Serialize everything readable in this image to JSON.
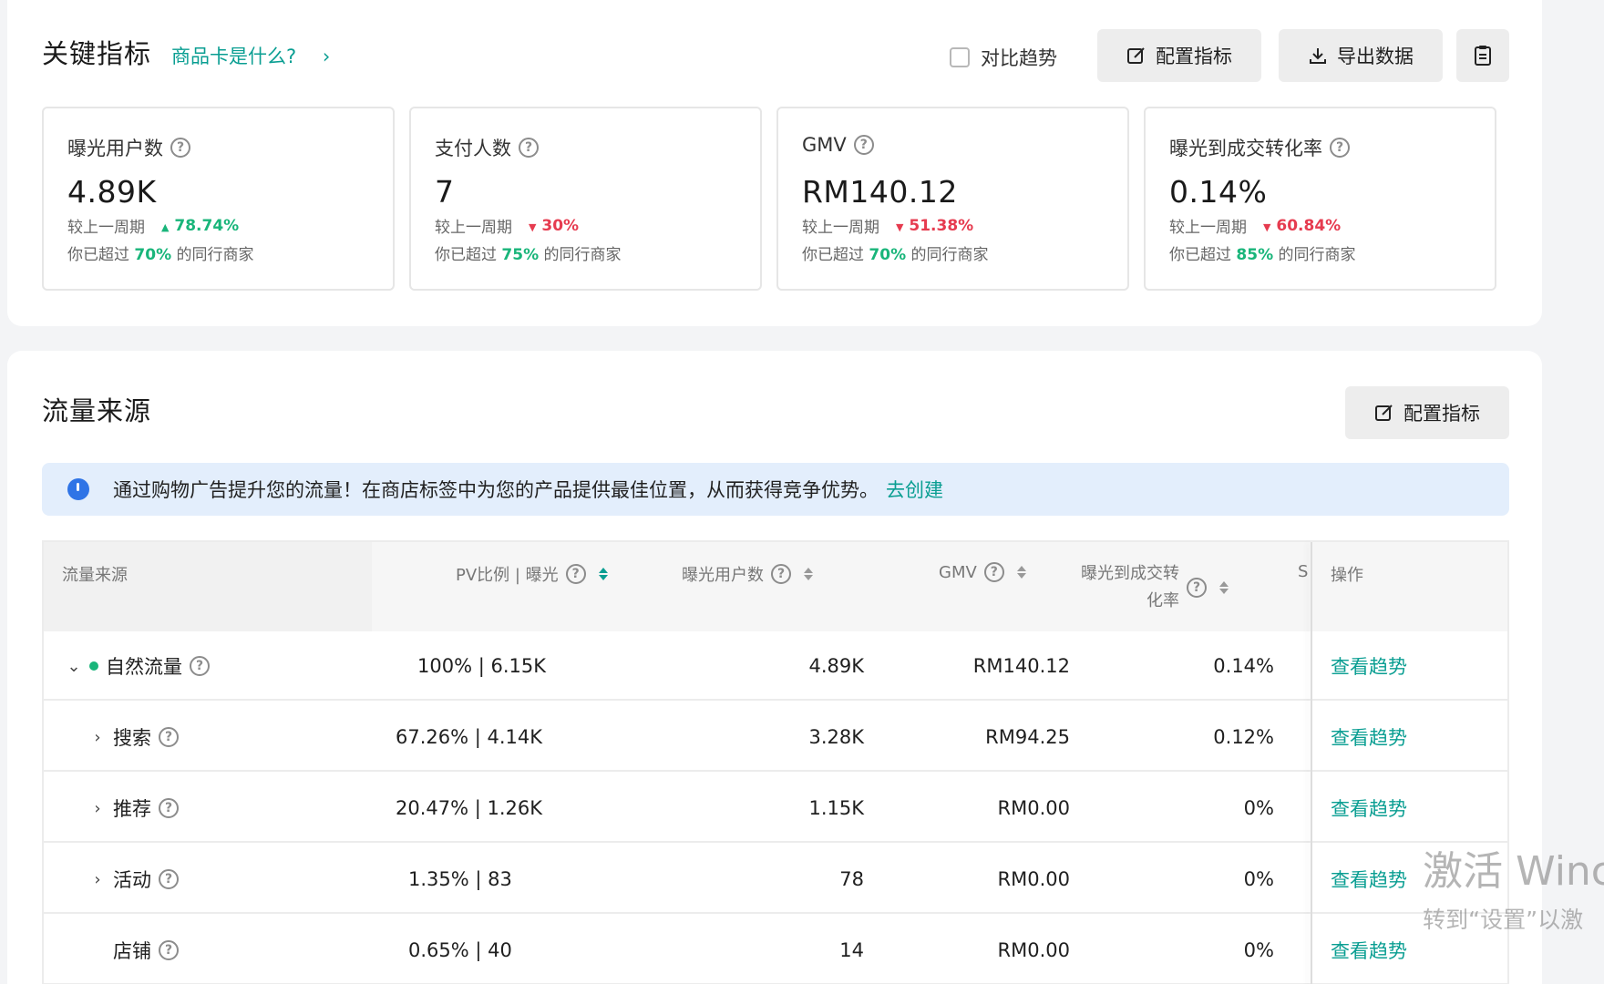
{
  "key_metrics": {
    "title": "关键指标",
    "help_link": "商品卡是什么?",
    "help_chevron": "›",
    "compare_label": "对比趋势",
    "config_button": "配置指标",
    "export_button": "导出数据",
    "cards": [
      {
        "title": "曝光用户数",
        "value": "4.89K",
        "compare_label": "较上一周期",
        "trend": "up",
        "trend_arrow": "▲",
        "change": "78.74%",
        "rank_prefix": "你已超过",
        "rank_pct": "70%",
        "rank_suffix": "的同行商家"
      },
      {
        "title": "支付人数",
        "value": "7",
        "compare_label": "较上一周期",
        "trend": "down",
        "trend_arrow": "▼",
        "change": "30%",
        "rank_prefix": "你已超过",
        "rank_pct": "75%",
        "rank_suffix": "的同行商家"
      },
      {
        "title": "GMV",
        "value": "RM140.12",
        "compare_label": "较上一周期",
        "trend": "down",
        "trend_arrow": "▼",
        "change": "51.38%",
        "rank_prefix": "你已超过",
        "rank_pct": "70%",
        "rank_suffix": "的同行商家"
      },
      {
        "title": "曝光到成交转化率",
        "value": "0.14%",
        "compare_label": "较上一周期",
        "trend": "down",
        "trend_arrow": "▼",
        "change": "60.84%",
        "rank_prefix": "你已超过",
        "rank_pct": "85%",
        "rank_suffix": "的同行商家"
      }
    ]
  },
  "traffic": {
    "title": "流量来源",
    "config_button": "配置指标",
    "banner_text": "通过购物广告提升您的流量！在商店标签中为您的产品提供最佳位置，从而获得竞争优势。",
    "banner_link": "去创建",
    "headers": {
      "source": "流量来源",
      "pv": "PV比例 | 曝光",
      "users": "曝光用户数",
      "gmv": "GMV",
      "conv_line1": "曝光到成交转",
      "conv_line2": "化率",
      "clipped": "S",
      "op": "操作"
    },
    "rows": [
      {
        "name": "自然流量",
        "chevron": "⌄",
        "pv": "100% | 6.15K",
        "users": "4.89K",
        "gmv": "RM140.12",
        "conv": "0.14%",
        "action": "查看趋势"
      },
      {
        "name": "搜索",
        "chevron": "›",
        "pv": "67.26% | 4.14K",
        "users": "3.28K",
        "gmv": "RM94.25",
        "conv": "0.12%",
        "action": "查看趋势"
      },
      {
        "name": "推荐",
        "chevron": "›",
        "pv": "20.47% | 1.26K",
        "users": "1.15K",
        "gmv": "RM0.00",
        "conv": "0%",
        "action": "查看趋势"
      },
      {
        "name": "活动",
        "chevron": "›",
        "pv": "1.35% | 83",
        "users": "78",
        "gmv": "RM0.00",
        "conv": "0%",
        "action": "查看趋势"
      },
      {
        "name": "店铺",
        "chevron": "",
        "pv": "0.65% | 40",
        "users": "14",
        "gmv": "RM0.00",
        "conv": "0%",
        "action": "查看趋势"
      }
    ]
  },
  "watermark": {
    "line1": "激活 Winc",
    "line2": "转到“设置”以激"
  },
  "colors": {
    "accent": "#0a9e92",
    "up": "#19b57a",
    "down": "#e63b4f",
    "banner_bg": "#e3eefc"
  }
}
